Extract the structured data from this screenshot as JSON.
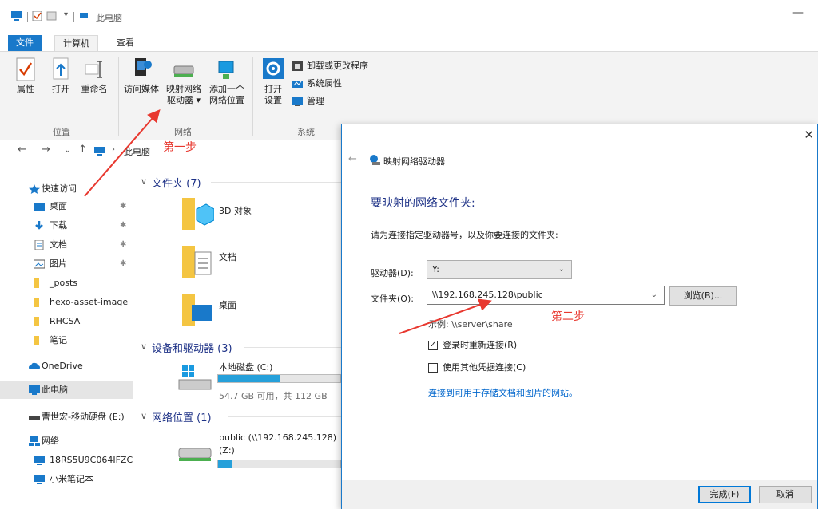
{
  "window": {
    "title": "此电脑",
    "minimize": "—"
  },
  "tabs": {
    "file": "文件",
    "computer": "计算机",
    "view": "查看"
  },
  "ribbon": {
    "location": {
      "label": "位置",
      "properties": "属性",
      "open": "打开",
      "rename": "重命名"
    },
    "network": {
      "label": "网络",
      "media": "访问媒体",
      "map_line1": "映射网络",
      "map_line2": "驱动器 ▾",
      "add_line1": "添加一个",
      "add_line2": "网络位置"
    },
    "system": {
      "label": "系统",
      "open_line1": "打开",
      "open_line2": "设置",
      "uninstall": "卸载或更改程序",
      "sysprops": "系统属性",
      "manage": "管理"
    }
  },
  "address": {
    "back": "←",
    "forward": "→",
    "down": "⌄",
    "up": "↑",
    "crumb": "此电脑",
    "step1": "第一步"
  },
  "nav": {
    "items": [
      {
        "label": "快速访问",
        "icon": "star-icon",
        "pin": ""
      },
      {
        "label": "桌面",
        "icon": "desktop-icon",
        "pin": "✱"
      },
      {
        "label": "下载",
        "icon": "download-icon",
        "pin": "✱"
      },
      {
        "label": "文档",
        "icon": "document-icon",
        "pin": "✱"
      },
      {
        "label": "图片",
        "icon": "picture-icon",
        "pin": "✱"
      },
      {
        "label": "_posts",
        "icon": "folder-icon",
        "pin": ""
      },
      {
        "label": "hexo-asset-image",
        "icon": "folder-icon",
        "pin": ""
      },
      {
        "label": "RHCSA",
        "icon": "folder-icon",
        "pin": ""
      },
      {
        "label": "笔记",
        "icon": "folder-icon",
        "pin": ""
      },
      {
        "label": "OneDrive",
        "icon": "cloud-icon",
        "pin": ""
      },
      {
        "label": "此电脑",
        "icon": "pc-icon",
        "pin": ""
      },
      {
        "label": "曹世宏-移动硬盘 (E:)",
        "icon": "drive-icon",
        "pin": ""
      },
      {
        "label": "网络",
        "icon": "network-icon",
        "pin": ""
      },
      {
        "label": "18RS5U9C064IFZC",
        "icon": "pc-icon",
        "pin": ""
      },
      {
        "label": "小米笔记本",
        "icon": "pc-icon",
        "pin": ""
      }
    ]
  },
  "content": {
    "folders_header": "文件夹 (7)",
    "folders": [
      "3D 对象",
      "文档",
      "桌面"
    ],
    "devices_header": "设备和驱动器 (3)",
    "drive_c": {
      "name": "本地磁盘 (C:)",
      "free": "54.7 GB 可用，共 112 GB",
      "fill": 0.51
    },
    "netloc_header": "网络位置 (1)",
    "netloc": {
      "name_line1": "public (\\\\192.168.245.128)",
      "name_line2": "(Z:)",
      "fill": 0.12
    }
  },
  "dialog": {
    "close": "✕",
    "back": "←",
    "title": "映射网络驱动器",
    "heading": "要映射的网络文件夹:",
    "instruction": "请为连接指定驱动器号，以及你要连接的文件夹:",
    "drive_label": "驱动器(D):",
    "drive_value": "Y:",
    "folder_label": "文件夹(O):",
    "folder_value": "\\\\192.168.245.128\\public",
    "browse": "浏览(B)...",
    "example": "示例: \\\\server\\share",
    "step2": "第二步",
    "reconnect": "登录时重新连接(R)",
    "reconnect_checked": "✓",
    "other_creds": "使用其他凭据连接(C)",
    "link": "连接到可用于存储文档和图片的网站。",
    "finish": "完成(F)",
    "cancel": "取消"
  },
  "colors": {
    "accent": "#1979ca",
    "annotation": "#e8382f",
    "heading": "#1e3287"
  }
}
